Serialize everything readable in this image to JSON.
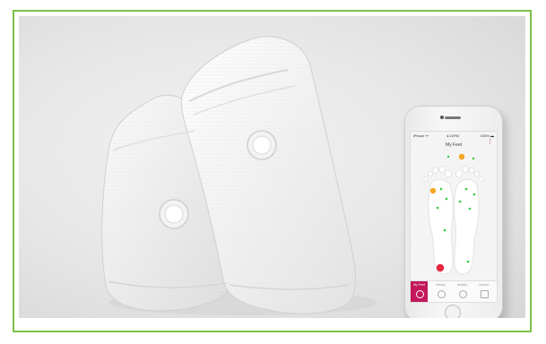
{
  "image": {
    "alt": "Two white smart socks with round sensors lying next to a smartphone showing a foot-pressure app"
  },
  "phone_app": {
    "status_carrier": "iPhone ᯤ",
    "status_time": "4:21PM",
    "status_battery": "100% ▬",
    "title": "My Feet",
    "tabs": [
      {
        "label": "My Feet",
        "icon": "feet-icon"
      },
      {
        "label": "History",
        "icon": "clock-icon"
      },
      {
        "label": "Activity",
        "icon": "activity-icon"
      },
      {
        "label": "Journal",
        "icon": "journal-icon"
      }
    ],
    "colors": {
      "accent": "#c2185b",
      "sensor_ok": "#2ecc40",
      "sensor_warn": "#f5a623",
      "sensor_alert": "#e8233d",
      "frame_border": "#7cc04a"
    }
  }
}
